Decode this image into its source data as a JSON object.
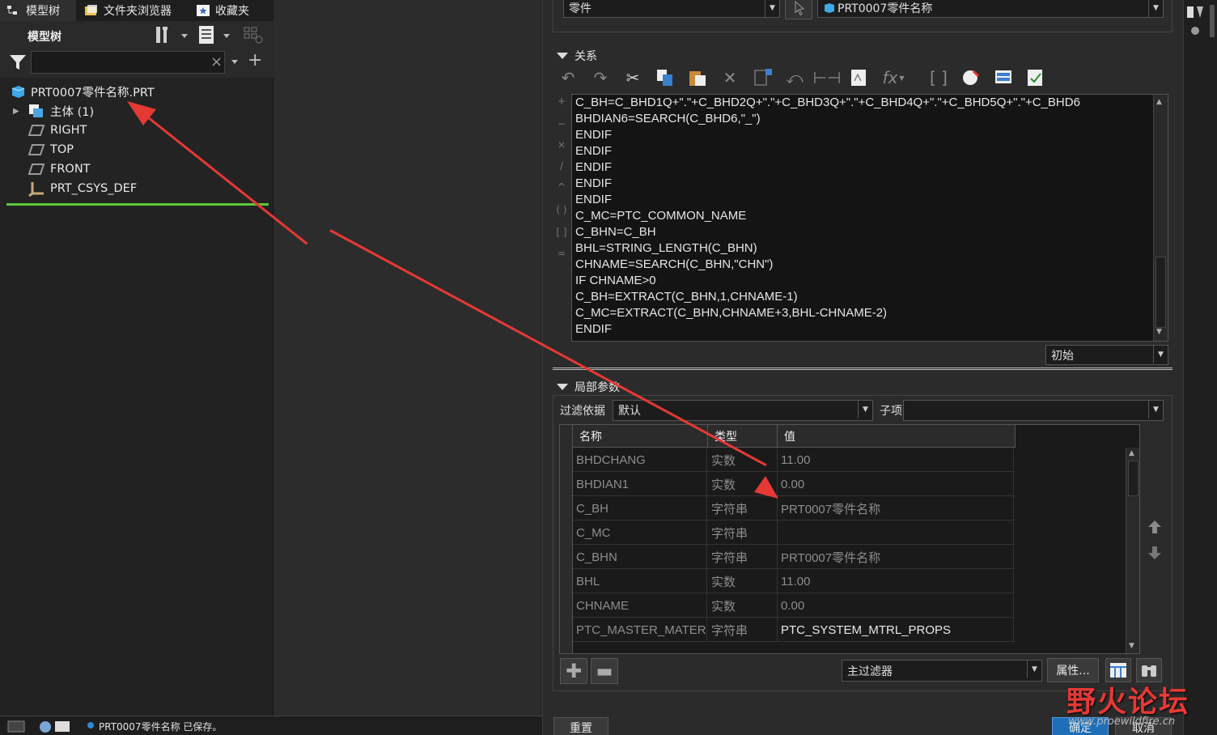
{
  "tabs": [
    {
      "label": "模型树",
      "icon": "model-tree-icon"
    },
    {
      "label": "文件夹浏览器",
      "icon": "folder-browser-icon"
    },
    {
      "label": "收藏夹",
      "icon": "favorites-icon"
    }
  ],
  "tree_header": {
    "title": "模型树"
  },
  "filter": {
    "value": "",
    "clear": "×",
    "add": "+"
  },
  "tree": {
    "root": "PRT0007零件名称.PRT",
    "items": [
      {
        "label": "主体 (1)",
        "icon": "body-icon"
      },
      {
        "label": "RIGHT",
        "icon": "datum-plane-icon"
      },
      {
        "label": "TOP",
        "icon": "datum-plane-icon"
      },
      {
        "label": "FRONT",
        "icon": "datum-plane-icon"
      },
      {
        "label": "PRT_CSYS_DEF",
        "icon": "csys-icon"
      }
    ]
  },
  "status": {
    "message": "PRT0007零件名称 已保存。"
  },
  "top": {
    "type_value": "零件",
    "model_value": "PRT0007零件名称"
  },
  "relations": {
    "title": "关系",
    "lines": [
      "C_BH=C_BHD1Q+\".\"+C_BHD2Q+\".\"+C_BHD3Q+\".\"+C_BHD4Q+\".\"+C_BHD5Q+\".\"+C_BHD6",
      "BHDIAN6=SEARCH(C_BHD6,\"_\")",
      "ENDIF",
      "ENDIF",
      "ENDIF",
      "ENDIF",
      "ENDIF",
      "C_MC=PTC_COMMON_NAME",
      "C_BHN=C_BH",
      "BHL=STRING_LENGTH(C_BHN)",
      "CHNAME=SEARCH(C_BHN,\"CHN\")",
      "IF CHNAME>0",
      "C_BH=EXTRACT(C_BHN,1,CHNAME-1)",
      "C_MC=EXTRACT(C_BHN,CHNAME+3,BHL-CHNAME-2)",
      "ENDIF"
    ],
    "initial_value": "初始"
  },
  "local_params": {
    "title": "局部参数",
    "filter_label": "过滤依据",
    "filter_value": "默认",
    "subitem_label": "子项",
    "subitem_value": "",
    "columns": [
      "名称",
      "类型",
      "值"
    ],
    "rows": [
      {
        "name": "BHDCHANG",
        "type": "实数",
        "value": "11.00",
        "bright": false
      },
      {
        "name": "BHDIAN1",
        "type": "实数",
        "value": "0.00",
        "bright": false
      },
      {
        "name": "C_BH",
        "type": "字符串",
        "value": "PRT0007零件名称",
        "bright": false
      },
      {
        "name": "C_MC",
        "type": "字符串",
        "value": "",
        "bright": false
      },
      {
        "name": "C_BHN",
        "type": "字符串",
        "value": "PRT0007零件名称",
        "bright": false
      },
      {
        "name": "BHL",
        "type": "实数",
        "value": "11.00",
        "bright": false
      },
      {
        "name": "CHNAME",
        "type": "实数",
        "value": "0.00",
        "bright": false
      },
      {
        "name": "PTC_MASTER_MATERIAL",
        "type": "字符串",
        "value": "PTC_SYSTEM_MTRL_PROPS",
        "bright": true
      }
    ],
    "main_filter": "主过滤器",
    "properties_button": "属性..."
  },
  "bottom": {
    "reset": "重置",
    "ok": "确定",
    "cancel": "取消"
  },
  "watermark": {
    "text": "野火论坛",
    "url": "www.proewildfire.cn"
  },
  "colors": {
    "accent_green": "#5cc93a",
    "annotation_red": "#e53935",
    "ok_blue": "#1e6fb8"
  }
}
